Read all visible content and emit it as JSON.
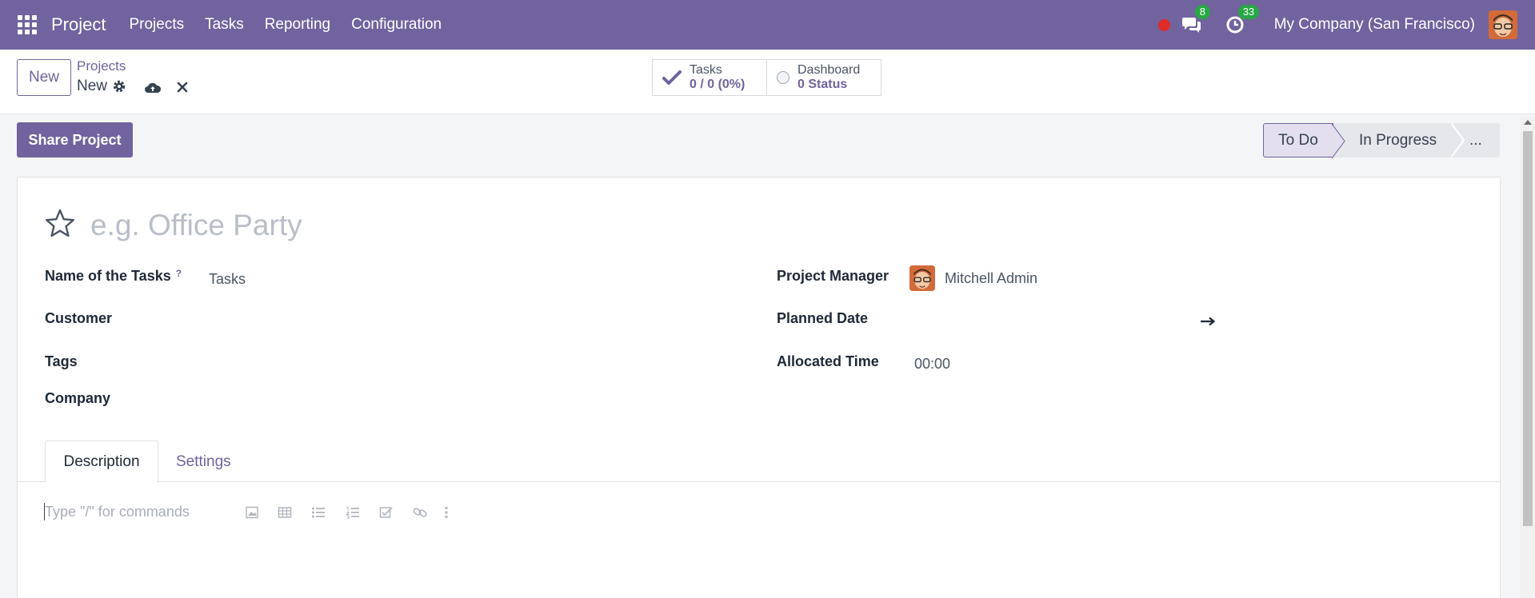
{
  "navbar": {
    "app_name": "Project",
    "menu": [
      "Projects",
      "Tasks",
      "Reporting",
      "Configuration"
    ],
    "messages_count": "8",
    "activities_count": "33",
    "company": "My Company (San Francisco)",
    "accent_color": "#71639e",
    "icons": [
      "apps-grid-icon",
      "recording-dot-icon",
      "chat-bubbles-icon",
      "clock-activity-icon",
      "user-avatar"
    ]
  },
  "control_panel": {
    "new_label": "New",
    "breadcrumb": "Projects",
    "record_name": "New",
    "smart_buttons": {
      "tasks_label": "Tasks",
      "tasks_value": "0 / 0 (0%)",
      "dashboard_label": "Dashboard",
      "dashboard_value": "0 Status"
    }
  },
  "status_bar": {
    "share_label": "Share Project",
    "stages": [
      "To Do",
      "In Progress",
      "..."
    ],
    "active_stage": "To Do"
  },
  "form": {
    "name_placeholder": "e.g. Office Party",
    "fields": {
      "task_name_label": "Name of the Tasks",
      "task_name_help": "?",
      "task_name_value": "Tasks",
      "customer_label": "Customer",
      "tags_label": "Tags",
      "company_label": "Company",
      "manager_label": "Project Manager",
      "manager_value": "Mitchell Admin",
      "planned_date_label": "Planned Date",
      "allocated_label": "Allocated Time",
      "allocated_value": "00:00"
    },
    "tabs": [
      "Description",
      "Settings"
    ],
    "active_tab": "Description",
    "editor_placeholder": "Type \"/\" for commands"
  }
}
